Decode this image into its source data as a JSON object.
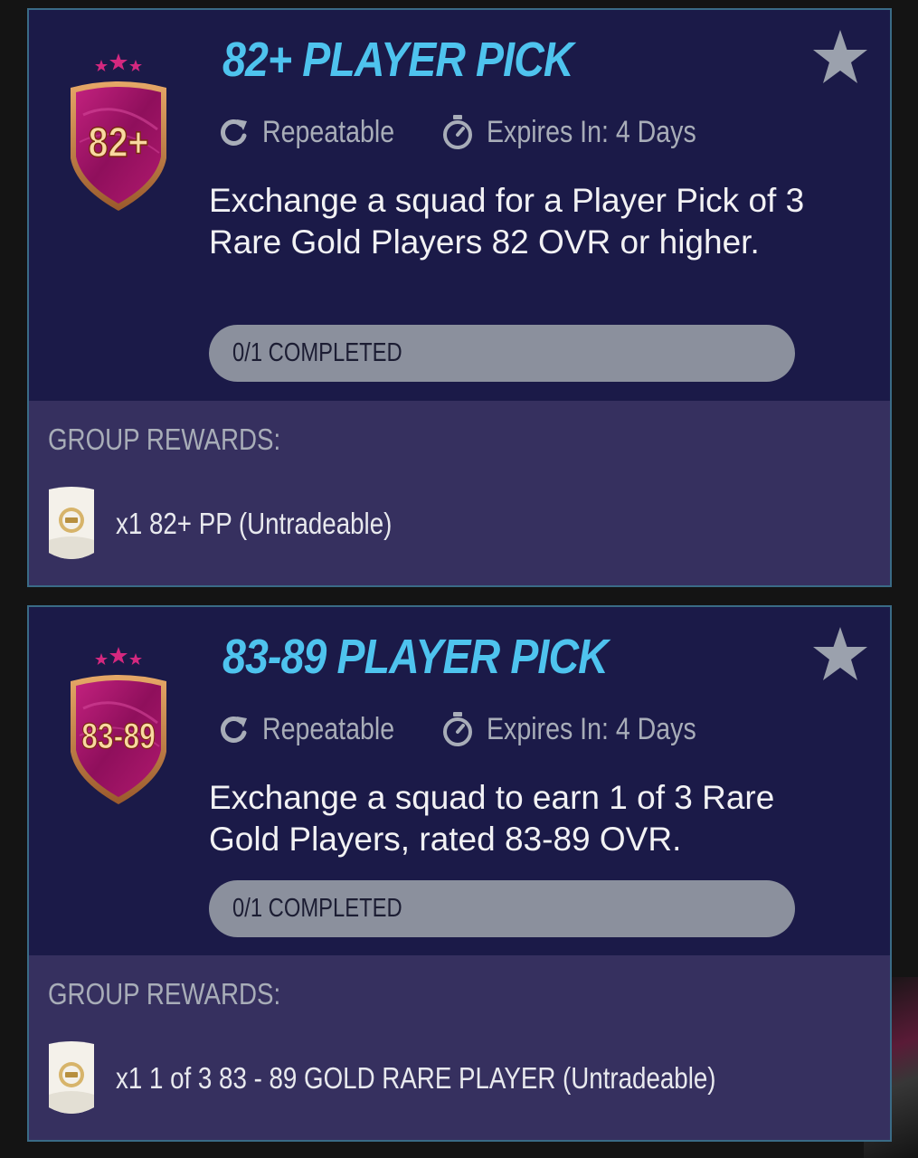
{
  "colors": {
    "page_background": "#141414",
    "card_background": "#1b1a48",
    "card_border": "#3a6b86",
    "rewards_background": "#36305f",
    "title": "#4ec3ee",
    "muted_text": "#a8adb8",
    "progress_bar": "#8b909d",
    "badge_magenta": "#a0166a",
    "badge_gold": "#c88a4a"
  },
  "challenges": [
    {
      "badge_label": "82+",
      "title": "82+ PLAYER PICK",
      "favorite_icon": "star-icon",
      "repeatable_icon": "refresh-icon",
      "repeatable_label": "Repeatable",
      "expiry_icon": "stopwatch-icon",
      "expiry_label": "Expires In: 4 Days",
      "description": "Exchange a squad for a Player Pick of 3 Rare Gold Players 82 OVR or higher.",
      "progress_label": "0/1 COMPLETED",
      "progress_fraction": 0,
      "rewards_heading": "GROUP REWARDS:",
      "reward_icon": "pack-icon",
      "reward_text": "x1 82+ PP (Untradeable)"
    },
    {
      "badge_label": "83-89",
      "title": "83-89 PLAYER PICK",
      "favorite_icon": "star-icon",
      "repeatable_icon": "refresh-icon",
      "repeatable_label": "Repeatable",
      "expiry_icon": "stopwatch-icon",
      "expiry_label": "Expires In: 4 Days",
      "description": "Exchange a squad to earn 1 of 3 Rare Gold Players, rated 83-89 OVR.",
      "progress_label": "0/1 COMPLETED",
      "progress_fraction": 0,
      "rewards_heading": "GROUP REWARDS:",
      "reward_icon": "pack-icon",
      "reward_text": "x1 1 of 3 83 - 89 GOLD RARE PLAYER (Untradeable)"
    }
  ]
}
